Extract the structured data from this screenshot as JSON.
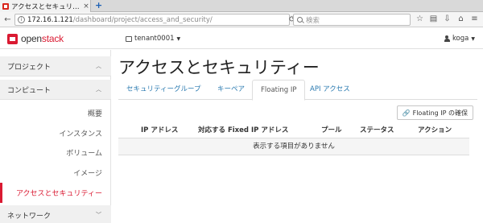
{
  "browser": {
    "tab_title": "アクセスとセキュリ…",
    "tab_close": "×",
    "new_tab": "+",
    "url_host": "172.16.1.121",
    "url_path": "/dashboard/project/access_and_security/",
    "search_placeholder": "検索"
  },
  "header": {
    "logo_brand": "open",
    "logo_accent": "stack",
    "project": "tenant0001",
    "user": "koga"
  },
  "sidebar": {
    "project_label": "プロジェクト",
    "compute_label": "コンピュート",
    "items": [
      {
        "label": "概要"
      },
      {
        "label": "インスタンス"
      },
      {
        "label": "ボリューム"
      },
      {
        "label": "イメージ"
      },
      {
        "label": "アクセスとセキュリティー"
      }
    ],
    "network_label": "ネットワーク",
    "active_color": "#da1a32"
  },
  "main": {
    "title": "アクセスとセキュリティー",
    "tabs": [
      {
        "label": "セキュリティーグループ"
      },
      {
        "label": "キーペア"
      },
      {
        "label": "Floating IP"
      },
      {
        "label": "API アクセス"
      }
    ],
    "allocate_button": "Floating IP の確保",
    "table": {
      "columns": [
        "IP アドレス",
        "対応する Fixed IP アドレス",
        "プール",
        "ステータス",
        "アクション"
      ],
      "empty_message": "表示する項目がありません"
    }
  }
}
